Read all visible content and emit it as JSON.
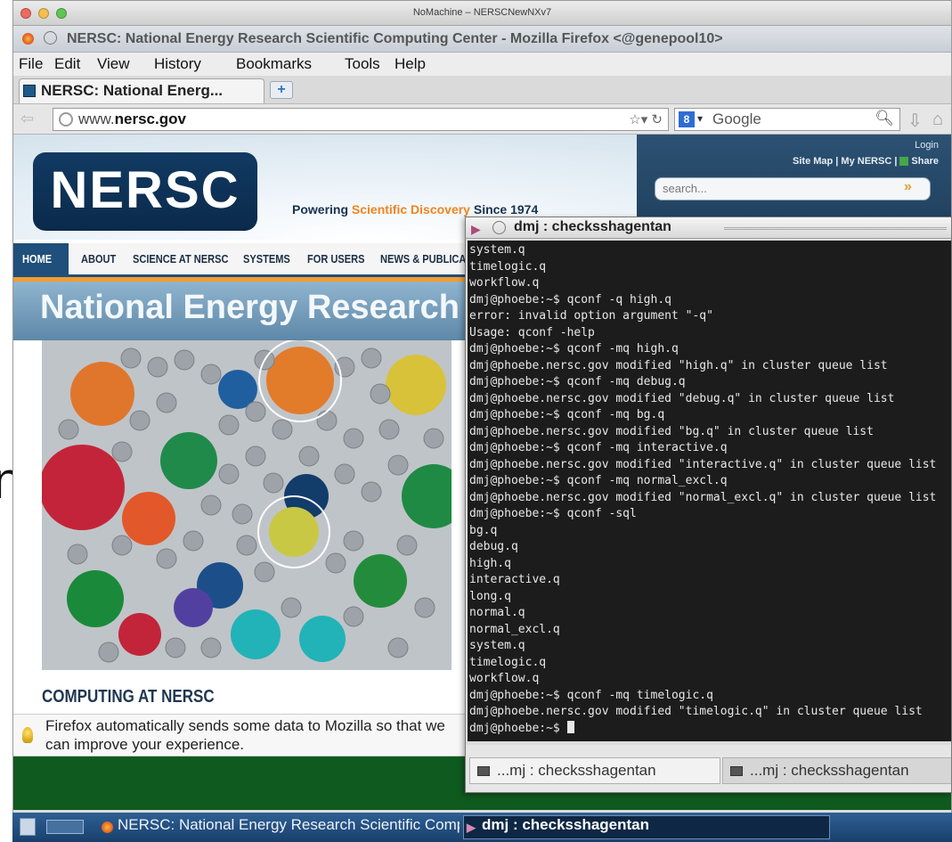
{
  "background": {
    "cropped_letter": "n"
  },
  "mac_window": {
    "title": "NoMachine – NERSCNewNXv7"
  },
  "firefox": {
    "window_title": "NERSC: National Energy Research Scientific Computing Center - Mozilla Firefox <@genepool10>",
    "menu": [
      "File",
      "Edit",
      "View",
      "History",
      "Bookmarks",
      "Tools",
      "Help"
    ],
    "tab_label": "NERSC: National Energ...",
    "new_tab": "+",
    "url": {
      "prefix": "www.",
      "domain": "nersc.gov"
    },
    "search_engine": "Google",
    "notification": "Firefox automatically sends some data to Mozilla so that we can improve your experience."
  },
  "site": {
    "logo": "NERSC",
    "tagline_pre": "Powering ",
    "tagline_accent": "Scientific Discovery",
    "tagline_post": " Since 1974",
    "login": "Login",
    "links": "Site Map | My NERSC |",
    "share": "Share",
    "search_placeholder": "search...",
    "nav": [
      "HOME",
      "ABOUT",
      "SCIENCE AT NERSC",
      "SYSTEMS",
      "FOR USERS",
      "NEWS & PUBLICATIONS"
    ],
    "banner_title": "National Energy Research Scientific Computing Center",
    "section_title": "COMPUTING AT NERSC",
    "colors": {
      "navy": "#1f4f7a",
      "orange": "#f39c2c"
    }
  },
  "terminal": {
    "title": "dmj : checksshagentan",
    "lines": [
      "system.q",
      "timelogic.q",
      "workflow.q",
      "dmj@phoebe:~$ qconf -q high.q",
      "error: invalid option argument \"-q\"",
      "Usage: qconf -help",
      "dmj@phoebe:~$ qconf -mq high.q",
      "dmj@phoebe.nersc.gov modified \"high.q\" in cluster queue list",
      "dmj@phoebe:~$ qconf -mq debug.q",
      "dmj@phoebe.nersc.gov modified \"debug.q\" in cluster queue list",
      "dmj@phoebe:~$ qconf -mq bg.q",
      "dmj@phoebe.nersc.gov modified \"bg.q\" in cluster queue list",
      "dmj@phoebe:~$ qconf -mq interactive.q",
      "dmj@phoebe.nersc.gov modified \"interactive.q\" in cluster queue list",
      "dmj@phoebe:~$ qconf -mq normal_excl.q",
      "dmj@phoebe.nersc.gov modified \"normal_excl.q\" in cluster queue list",
      "dmj@phoebe:~$ qconf -sql",
      "bg.q",
      "debug.q",
      "high.q",
      "interactive.q",
      "long.q",
      "normal.q",
      "normal_excl.q",
      "system.q",
      "timelogic.q",
      "workflow.q",
      "dmj@phoebe:~$ qconf -mq timelogic.q",
      "dmj@phoebe.nersc.gov modified \"timelogic.q\" in cluster queue list"
    ],
    "prompt": "dmj@phoebe:~$ ",
    "tabs": [
      "...mj : checksshagentan",
      "...mj : checksshagentan"
    ]
  },
  "taskbar": {
    "firefox_task": "NERSC: National Energy Research Scientific Computing Center",
    "terminal_task": "dmj : checksshagentan"
  }
}
